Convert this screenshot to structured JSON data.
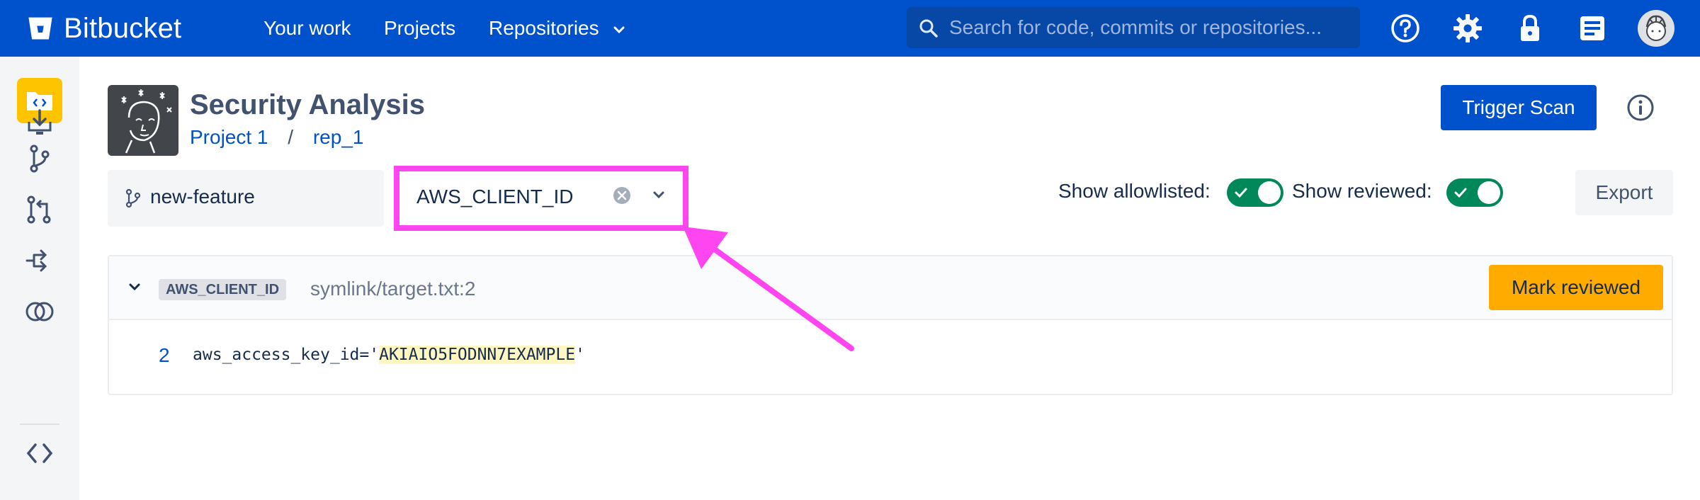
{
  "app": {
    "name": "Bitbucket",
    "brand_color": "#0052cc"
  },
  "topnav": {
    "links": [
      "Your work",
      "Projects",
      "Repositories"
    ],
    "search_placeholder": "Search for code, commits or repositories..."
  },
  "page": {
    "title": "Security Analysis",
    "breadcrumb": {
      "project": "Project 1",
      "separator": "/",
      "repo": "rep_1"
    },
    "trigger_button": "Trigger Scan"
  },
  "filters": {
    "branch": "new-feature",
    "secret_type": "AWS_CLIENT_ID",
    "show_allowlisted_label": "Show allowlisted:",
    "show_allowlisted": true,
    "show_reviewed_label": "Show reviewed:",
    "show_reviewed": true,
    "export_button": "Export",
    "highlight_color": "#ff45f0"
  },
  "results": [
    {
      "rule": "AWS_CLIENT_ID",
      "location": "symlink/target.txt:2",
      "action": "Mark reviewed",
      "line_number": "2",
      "code_prefix": "aws_access_key_id='",
      "code_match": "AKIAIO5FODNN7EXAMPLE",
      "code_suffix": "'"
    }
  ]
}
